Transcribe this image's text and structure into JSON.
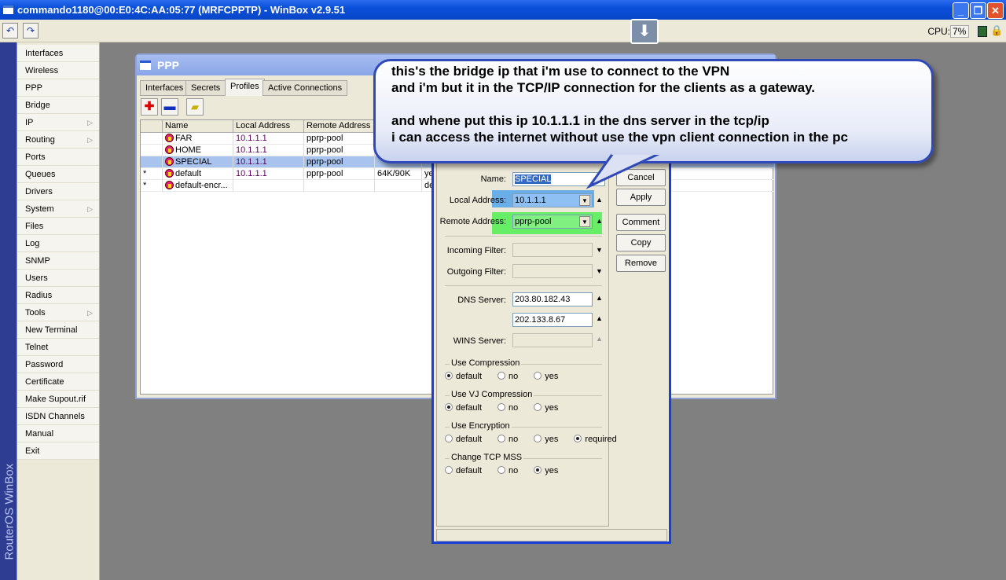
{
  "window": {
    "title": "commando1180@00:E0:4C:AA:05:77 (MRFCPPTP) - WinBox v2.9.51",
    "cpu_label": "CPU:",
    "cpu_value": "7%"
  },
  "brand": "RouterOS WinBox",
  "menu": [
    {
      "label": "Interfaces"
    },
    {
      "label": "Wireless"
    },
    {
      "label": "PPP"
    },
    {
      "label": "Bridge"
    },
    {
      "label": "IP",
      "sub": true
    },
    {
      "label": "Routing",
      "sub": true
    },
    {
      "label": "Ports"
    },
    {
      "label": "Queues"
    },
    {
      "label": "Drivers"
    },
    {
      "label": "System",
      "sub": true
    },
    {
      "label": "Files"
    },
    {
      "label": "Log"
    },
    {
      "label": "SNMP"
    },
    {
      "label": "Users"
    },
    {
      "label": "Radius"
    },
    {
      "label": "Tools",
      "sub": true
    },
    {
      "label": "New Terminal"
    },
    {
      "label": "Telnet"
    },
    {
      "label": "Password"
    },
    {
      "label": "Certificate"
    },
    {
      "label": "Make Supout.rif"
    },
    {
      "label": "ISDN Channels"
    },
    {
      "label": "Manual"
    },
    {
      "label": "Exit"
    }
  ],
  "ppp": {
    "title": "PPP",
    "tabs": [
      "Interfaces",
      "Secrets",
      "Profiles",
      "Active Connections"
    ],
    "active_tab": "Profiles",
    "columns": [
      "Name",
      "Local Address",
      "Remote Address"
    ],
    "rows": [
      {
        "flag": "",
        "name": "FAR",
        "local": "10.1.1.1",
        "remote": "pprp-pool",
        "rate": "",
        "extra": ""
      },
      {
        "flag": "",
        "name": "HOME",
        "local": "10.1.1.1",
        "remote": "pprp-pool",
        "rate": "",
        "extra": ""
      },
      {
        "flag": "",
        "name": "SPECIAL",
        "local": "10.1.1.1",
        "remote": "pprp-pool",
        "rate": "",
        "extra": "",
        "selected": true
      },
      {
        "flag": "*",
        "name": "default",
        "local": "10.1.1.1",
        "remote": "pprp-pool",
        "rate": "64K/90K",
        "extra": "ye"
      },
      {
        "flag": "*",
        "name": "default-encr...",
        "local": "",
        "remote": "",
        "rate": "",
        "extra": "de"
      }
    ]
  },
  "profile": {
    "name_label": "Name:",
    "name": "SPECIAL",
    "local_label": "Local Address:",
    "local": "10.1.1.1",
    "remote_label": "Remote Address:",
    "remote": "pprp-pool",
    "in_label": "Incoming Filter:",
    "out_label": "Outgoing Filter:",
    "dns_label": "DNS Server:",
    "dns1": "203.80.182.43",
    "dns2": "202.133.8.67",
    "wins_label": "WINS Server:",
    "groups": [
      {
        "title": "Use Compression",
        "options": [
          "default",
          "no",
          "yes"
        ],
        "selected": "default"
      },
      {
        "title": "Use VJ Compression",
        "options": [
          "default",
          "no",
          "yes"
        ],
        "selected": "default"
      },
      {
        "title": "Use Encryption",
        "options": [
          "default",
          "no",
          "yes",
          "required"
        ],
        "selected": "required"
      },
      {
        "title": "Change TCP MSS",
        "options": [
          "default",
          "no",
          "yes"
        ],
        "selected": "yes"
      }
    ],
    "buttons": [
      "Cancel",
      "Apply",
      "Comment",
      "Copy",
      "Remove"
    ],
    "highlight_local": "#6aaee8",
    "highlight_remote": "#66ee66"
  },
  "callout": {
    "lines": [
      "this's the bridge ip that i'm use to connect to the VPN",
      "and i'm but it in the TCP/IP connection for the clients as a gateway.",
      "",
      "and whene put this ip 10.1.1.1 in the dns server in the tcp/ip",
      "i can access the internet without use  the vpn client connection in the pc"
    ]
  }
}
